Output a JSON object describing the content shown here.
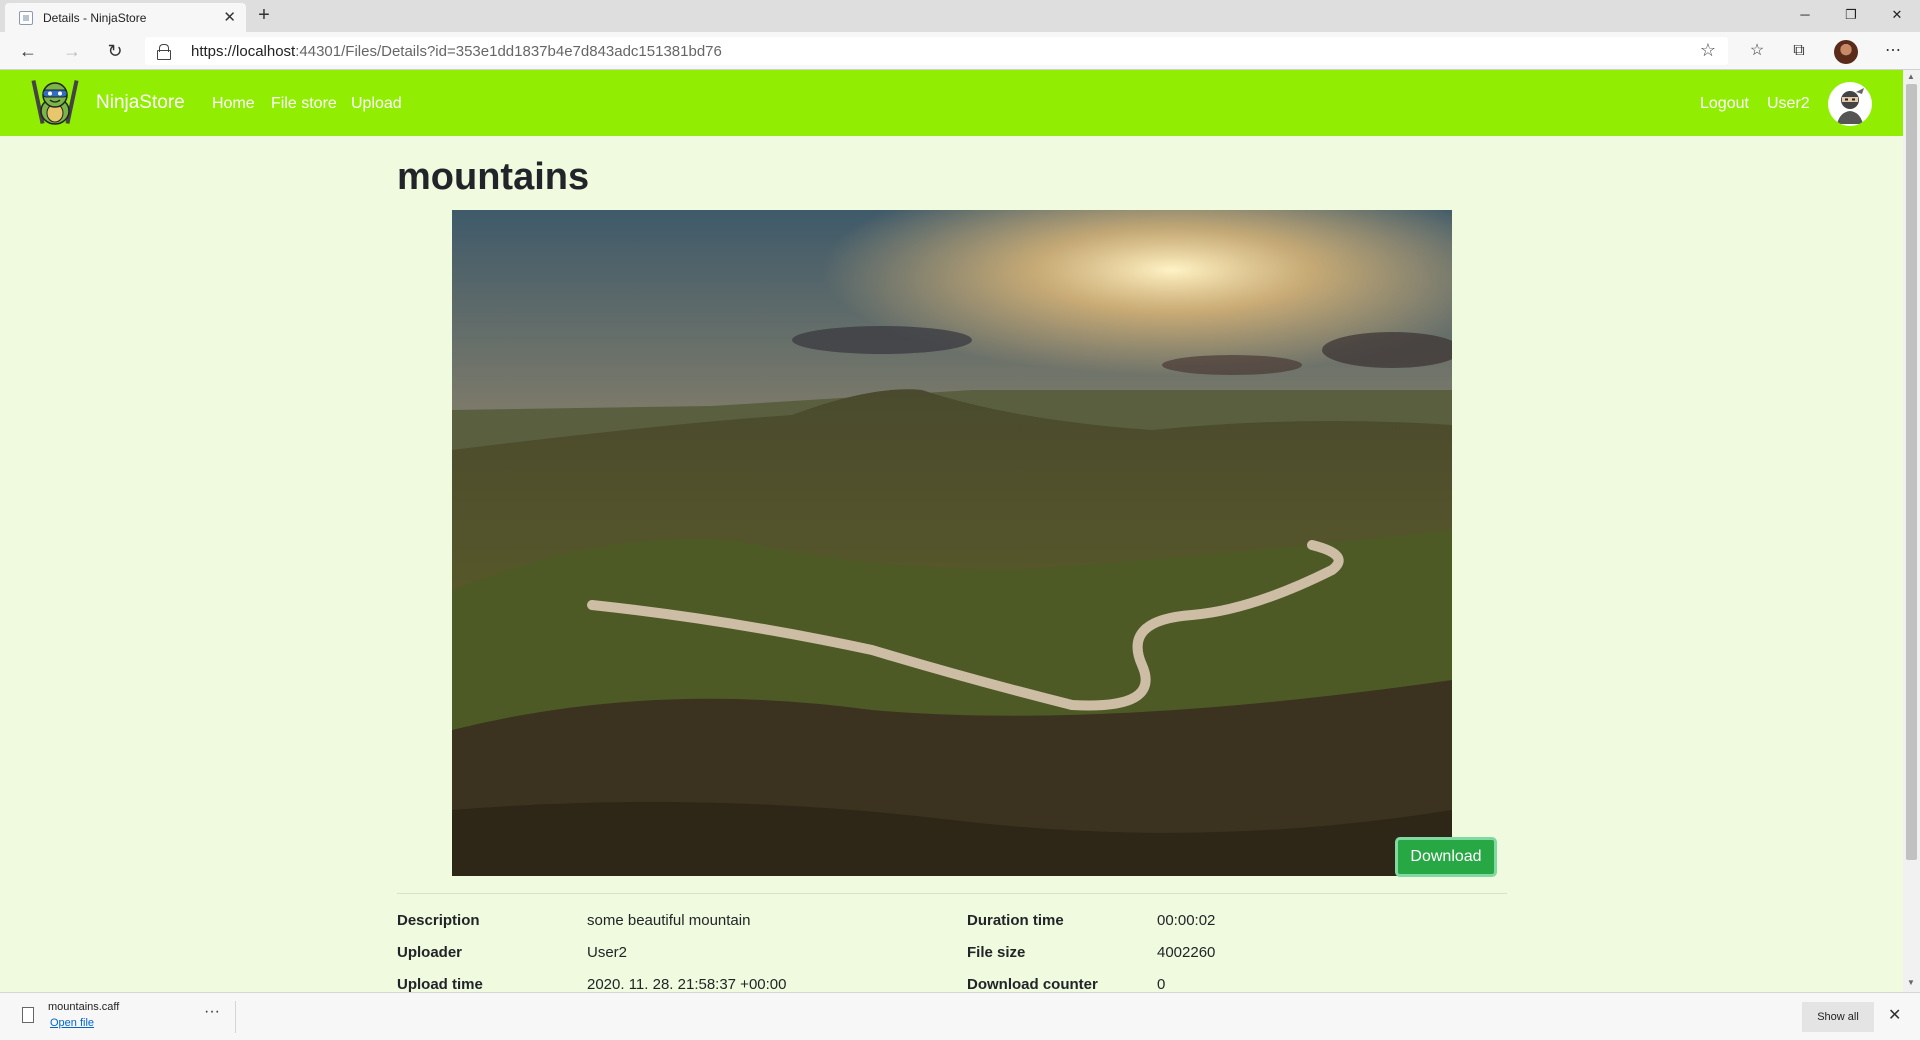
{
  "browser": {
    "tab_title": "Details - NinjaStore",
    "tab_close": "✕",
    "new_tab": "+",
    "url_domain": "https://localhost",
    "url_path": ":44301/Files/Details?id=353e1dd1837b4e7d843adc151381bd76",
    "window_controls": [
      "─",
      "❐",
      "✕"
    ]
  },
  "navbar": {
    "brand": "NinjaStore",
    "links": [
      "Home",
      "File store",
      "Upload"
    ],
    "logout": "Logout",
    "user": "User2",
    "accent": "#91ee03"
  },
  "file": {
    "title": "mountains",
    "download_label": "Download",
    "details_left": [
      {
        "label": "Description",
        "value": "some beautiful mountain"
      },
      {
        "label": "Uploader",
        "value": "User2"
      },
      {
        "label": "Upload time",
        "value": "2020. 11. 28. 21:58:37 +00:00"
      }
    ],
    "details_right": [
      {
        "label": "Duration time",
        "value": "00:00:02"
      },
      {
        "label": "File size",
        "value": "4002260"
      },
      {
        "label": "Download counter",
        "value": "0"
      }
    ]
  },
  "download_shelf": {
    "filename": "mountains.caff",
    "open_label": "Open file",
    "more": "···",
    "show_all": "Show all",
    "close": "✕"
  }
}
